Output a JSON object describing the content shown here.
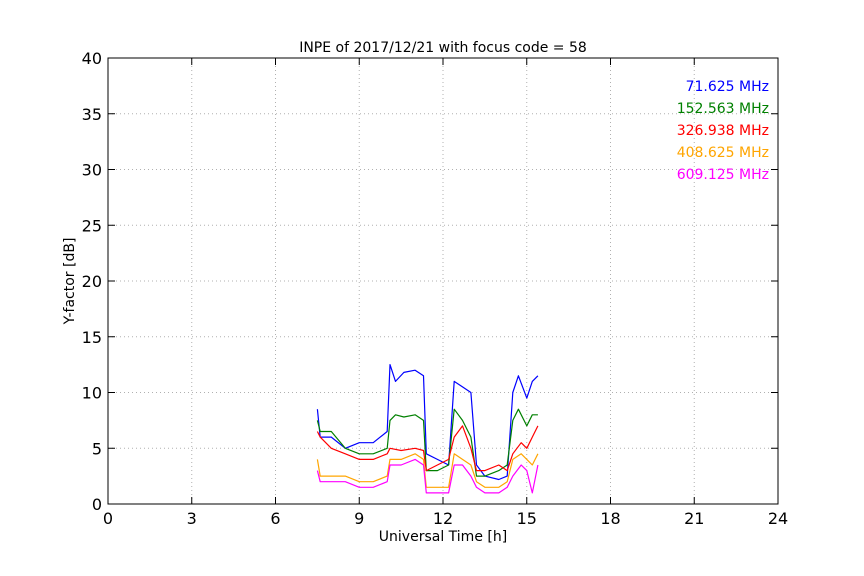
{
  "chart_data": {
    "type": "line",
    "title": "INPE of 2017/12/21 with focus code = 58",
    "xlabel": "Universal Time [h]",
    "ylabel": "Y-factor [dB]",
    "xlim": [
      0,
      24
    ],
    "ylim": [
      0,
      40
    ],
    "xticks": [
      0,
      3,
      6,
      9,
      12,
      15,
      18,
      21,
      24
    ],
    "yticks": [
      0,
      5,
      10,
      15,
      20,
      25,
      30,
      35,
      40
    ],
    "grid": true,
    "legend_placement": "top-right",
    "series": [
      {
        "name": "71.625 MHz",
        "color": "#0000ff",
        "x": [
          7.5,
          7.6,
          8.0,
          8.5,
          9.0,
          9.5,
          10.0,
          10.1,
          10.3,
          10.6,
          11.0,
          11.3,
          11.4,
          11.8,
          12.2,
          12.4,
          12.7,
          13.0,
          13.2,
          13.5,
          14.0,
          14.3,
          14.5,
          14.7,
          15.0,
          15.2,
          15.4
        ],
        "y": [
          8.5,
          6.0,
          6.0,
          5.0,
          5.5,
          5.5,
          6.5,
          12.5,
          11.0,
          11.8,
          12.0,
          11.5,
          4.5,
          4.0,
          3.5,
          11.0,
          10.5,
          10.0,
          3.5,
          2.5,
          2.2,
          2.5,
          10.0,
          11.5,
          9.5,
          11.0,
          11.5
        ]
      },
      {
        "name": "152.563 MHz",
        "color": "#008000",
        "x": [
          7.5,
          7.6,
          8.0,
          8.5,
          9.0,
          9.5,
          10.0,
          10.1,
          10.3,
          10.6,
          11.0,
          11.3,
          11.4,
          11.8,
          12.2,
          12.4,
          12.7,
          13.0,
          13.2,
          13.5,
          14.0,
          14.3,
          14.5,
          14.7,
          15.0,
          15.2,
          15.4
        ],
        "y": [
          7.5,
          6.5,
          6.5,
          5.0,
          4.5,
          4.5,
          5.0,
          7.5,
          8.0,
          7.8,
          8.0,
          7.5,
          3.0,
          3.0,
          3.5,
          8.5,
          7.5,
          6.0,
          2.5,
          2.5,
          3.0,
          3.5,
          7.5,
          8.5,
          7.0,
          8.0,
          8.0
        ]
      },
      {
        "name": "326.938 MHz",
        "color": "#ff0000",
        "x": [
          7.5,
          7.6,
          8.0,
          8.5,
          9.0,
          9.5,
          10.0,
          10.1,
          10.5,
          11.0,
          11.3,
          11.4,
          11.8,
          12.2,
          12.4,
          12.7,
          13.0,
          13.2,
          13.5,
          14.0,
          14.3,
          14.5,
          14.8,
          15.0,
          15.2,
          15.4
        ],
        "y": [
          6.5,
          6.0,
          5.0,
          4.5,
          4.0,
          4.0,
          4.5,
          5.0,
          4.8,
          5.0,
          4.8,
          3.0,
          3.5,
          4.0,
          6.0,
          7.0,
          5.0,
          3.0,
          3.0,
          3.5,
          3.0,
          4.5,
          5.5,
          5.0,
          6.0,
          7.0
        ]
      },
      {
        "name": "408.625 MHz",
        "color": "#ffa500",
        "x": [
          7.5,
          7.6,
          8.0,
          8.5,
          9.0,
          9.5,
          10.0,
          10.1,
          10.5,
          11.0,
          11.3,
          11.4,
          11.8,
          12.2,
          12.4,
          12.7,
          13.0,
          13.2,
          13.5,
          14.0,
          14.3,
          14.5,
          14.8,
          15.0,
          15.2,
          15.4
        ],
        "y": [
          4.0,
          2.5,
          2.5,
          2.5,
          2.0,
          2.0,
          2.5,
          4.0,
          4.0,
          4.5,
          4.0,
          1.5,
          1.5,
          1.5,
          4.5,
          4.0,
          3.5,
          2.0,
          1.5,
          1.5,
          2.0,
          4.0,
          4.5,
          4.0,
          3.5,
          4.5
        ]
      },
      {
        "name": "609.125 MHz",
        "color": "#ff00ff",
        "x": [
          7.5,
          7.6,
          8.0,
          8.5,
          9.0,
          9.5,
          10.0,
          10.1,
          10.5,
          11.0,
          11.3,
          11.4,
          11.8,
          12.2,
          12.4,
          12.7,
          13.0,
          13.2,
          13.5,
          14.0,
          14.3,
          14.5,
          14.8,
          15.0,
          15.2,
          15.4
        ],
        "y": [
          3.0,
          2.0,
          2.0,
          2.0,
          1.5,
          1.5,
          2.0,
          3.5,
          3.5,
          4.0,
          3.5,
          1.0,
          1.0,
          1.0,
          3.5,
          3.5,
          2.5,
          1.5,
          1.0,
          1.0,
          1.5,
          2.5,
          3.5,
          3.0,
          1.0,
          3.5
        ]
      }
    ]
  }
}
